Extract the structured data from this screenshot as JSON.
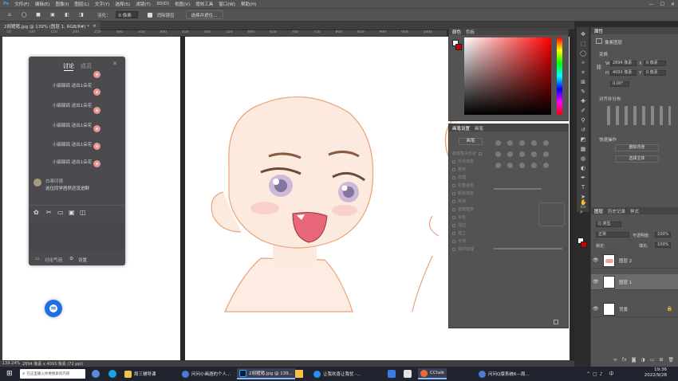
{
  "menubar": {
    "items": [
      "文件(F)",
      "编辑(E)",
      "图像(I)",
      "图层(L)",
      "文字(Y)",
      "选择(S)",
      "滤镜(T)",
      "3D(D)",
      "视图(V)",
      "增效工具",
      "窗口(W)",
      "帮助(H)"
    ],
    "controls": [
      "—",
      "☐",
      "✕"
    ]
  },
  "optionsbar": {
    "feather_label": "羽化：",
    "feather_value": "0 像素",
    "antialias_label": "消除锯齿",
    "select_mask_button": "选择并遮住…"
  },
  "document": {
    "tab_title": "2胡猪猪.jpg @ 139% (图层 1, RGB/8#) *",
    "ruler_ticks": [
      "50",
      "100",
      "150",
      "200",
      "250",
      "300",
      "350",
      "400",
      "450",
      "500",
      "550",
      "600",
      "650",
      "700",
      "750",
      "800",
      "850",
      "900",
      "950",
      "1000"
    ]
  },
  "chat": {
    "tabs": [
      "讨论",
      "成员"
    ],
    "close": "✕",
    "gift_messages": [
      {
        "text": "小甜甜鸽 送出1朵花"
      },
      {
        "text": "小甜甜鸽 送出1朵花"
      },
      {
        "text": "小甜甜鸽 送出1朵花"
      },
      {
        "text": "小甜甜鸽 送出1朵花"
      },
      {
        "text": "小甜甜鸽 送出1朵花"
      }
    ],
    "user_name": "白寒印德",
    "user_message": "这位同学居然还没进群",
    "footer_label": "讨论气泡",
    "settings_label": "设置"
  },
  "panels": {
    "color_tabs": [
      "颜色",
      "色板"
    ],
    "brush_tabs": [
      "画笔设置",
      "画笔"
    ],
    "brush_button": "画笔",
    "brush_options": [
      "画笔笔尖形状",
      "形状动态",
      "散布",
      "纹理",
      "双重画笔",
      "颜色动态",
      "传递",
      "画笔笔势",
      "杂色",
      "湿边",
      "建立",
      "平滑",
      "保护纹理"
    ],
    "properties_tabs": [
      "属性"
    ],
    "pixel_layer_label": "像素图层",
    "transform_label": "变换",
    "w_label": "W",
    "w_value": "2894 像素",
    "x_label": "X",
    "x_value": "0 像素",
    "h_label": "H",
    "h_value": "4093 像素",
    "y_label": "Y",
    "y_value": "0 像素",
    "angle_value": "0.00°",
    "align_label": "对齐并分布",
    "quick_actions_label": "快速操作",
    "remove_bg_button": "删除背景",
    "select_subject_button": "选择主体"
  },
  "layers": {
    "tabs": [
      "图层",
      "历史记录",
      "样式"
    ],
    "filter_label": "Q 类型",
    "blend_mode": "正常",
    "opacity_label": "不透明度:",
    "opacity_value": "100%",
    "lock_label": "锁定:",
    "fill_label": "填充:",
    "fill_value": "100%",
    "items": [
      {
        "name": "图层 2"
      },
      {
        "name": "图层 1"
      },
      {
        "name": "背景"
      }
    ]
  },
  "statusbar": {
    "zoom": "139.24%",
    "doc_size": "2894 像素 x 4093 像素 (72 ppi)"
  },
  "taskbar": {
    "search_placeholder": "在这里输入你要搜索的内容",
    "apps": [
      {
        "label": "周三辅导课"
      },
      {
        "label": "问问小画酒的个人..."
      },
      {
        "label": "2胡猪猪.jpg @ 139..."
      },
      {
        "label": "让我欢喜让我忧 -..."
      },
      {
        "label": "CCtalk"
      },
      {
        "label": "问问Q版系统6—周..."
      }
    ],
    "time": "19:36",
    "date": "2022/9/28"
  }
}
